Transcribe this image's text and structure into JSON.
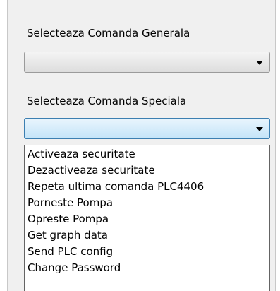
{
  "general_command": {
    "label": "Selecteaza Comanda Generala",
    "value": ""
  },
  "special_command": {
    "label": "Selecteaza Comanda Speciala",
    "value": "",
    "options": [
      "Activeaza securitate",
      "Dezactiveaza securitate",
      "Repeta ultima comanda PLC4406",
      "Porneste Pompa",
      "Opreste Pompa",
      "Get graph data",
      "Send PLC config",
      "Change Password"
    ]
  },
  "colors": {
    "panel_bg": "#f0f0f0",
    "combo_active_border": "#3c7fb1"
  }
}
